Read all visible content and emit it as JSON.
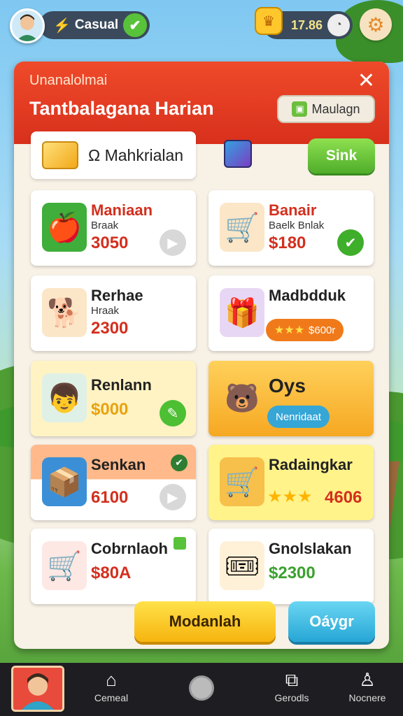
{
  "topbar": {
    "mode_label": "Casual",
    "coins": "17.86"
  },
  "panel": {
    "subtitle": "Unanalolmai",
    "title": "Tantbalagana Harian",
    "manage_label": "Maulagn",
    "filter_label": "Ω Mahkrialan",
    "sink_label": "Sink"
  },
  "cards": [
    {
      "name": "Maniaan",
      "sub": "Braak",
      "price": "3050"
    },
    {
      "name": "Banair",
      "sub": "Baelk Bnlak",
      "price": "$180"
    },
    {
      "name": "Rerhae",
      "sub": "Hraak",
      "price": "2300"
    },
    {
      "name": "Madbdduk",
      "tag": "$600r",
      "stars": "★★★"
    },
    {
      "name": "Renlann",
      "price": "$000"
    },
    {
      "name": "Oys",
      "tag": "Nenridaat"
    },
    {
      "name": "Senkan",
      "price": "6100"
    },
    {
      "name": "Radaingkar",
      "price": "4606",
      "stars": "★★★"
    },
    {
      "name": "Cobrnlaoh",
      "price": "$80A"
    },
    {
      "name": "Gnolslakan",
      "price": "$2300"
    }
  ],
  "buttons": {
    "main": "Modanlah",
    "secondary": "Oáygr"
  },
  "nav": {
    "items": [
      {
        "label": "Cemeal",
        "icon": "home-icon"
      },
      {
        "label": "Gerodls",
        "icon": "cast-icon"
      },
      {
        "label": "Nocnere",
        "icon": "profile-icon"
      }
    ]
  }
}
